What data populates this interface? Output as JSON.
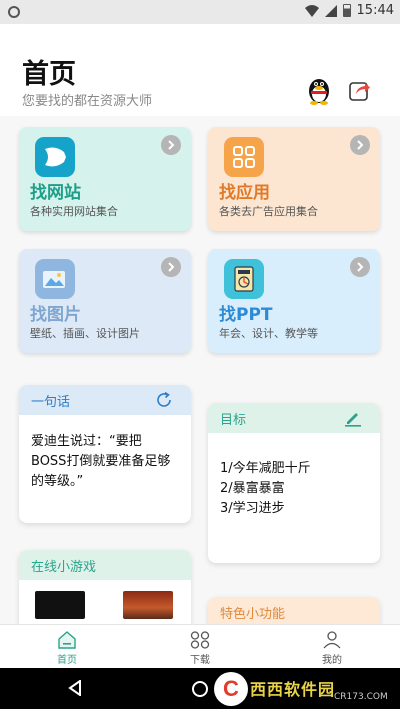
{
  "status_bar": {
    "time": "15:44"
  },
  "header": {
    "title": "首页",
    "subtitle": "您要找的都在资源大师"
  },
  "tiles": [
    {
      "name": "找网站",
      "desc": "各种实用网站集合",
      "name_color": "#1e9f8a"
    },
    {
      "name": "找应用",
      "desc": "各类去广告应用集合",
      "name_color": "#e07a28"
    },
    {
      "name": "找图片",
      "desc": "壁纸、插画、设计图片",
      "name_color": "#7fa6cf"
    },
    {
      "name": "找PPT",
      "desc": "年会、设计、教学等",
      "name_color": "#2d8bd6"
    }
  ],
  "quote_card": {
    "title": "一句话",
    "text": "爱迪生说过：“要把BOSS打倒就要准备足够的等级。”"
  },
  "goal_card": {
    "title": "目标",
    "items": [
      "1/今年减肥十斤",
      "2/暴富暴富",
      "3/学习进步"
    ]
  },
  "games_card": {
    "title": "在线小游戏"
  },
  "features_card": {
    "title": "特色小功能"
  },
  "tabbar": {
    "tabs": [
      {
        "label": "首页",
        "active": true
      },
      {
        "label": "下载",
        "active": false
      },
      {
        "label": "我的",
        "active": false
      }
    ]
  },
  "watermark": {
    "logo": "C",
    "text": "西西软件园",
    "url": "CR173.COM"
  },
  "colors": {
    "accent": "#2aa38c",
    "quote_title": "#2d7dc7"
  }
}
